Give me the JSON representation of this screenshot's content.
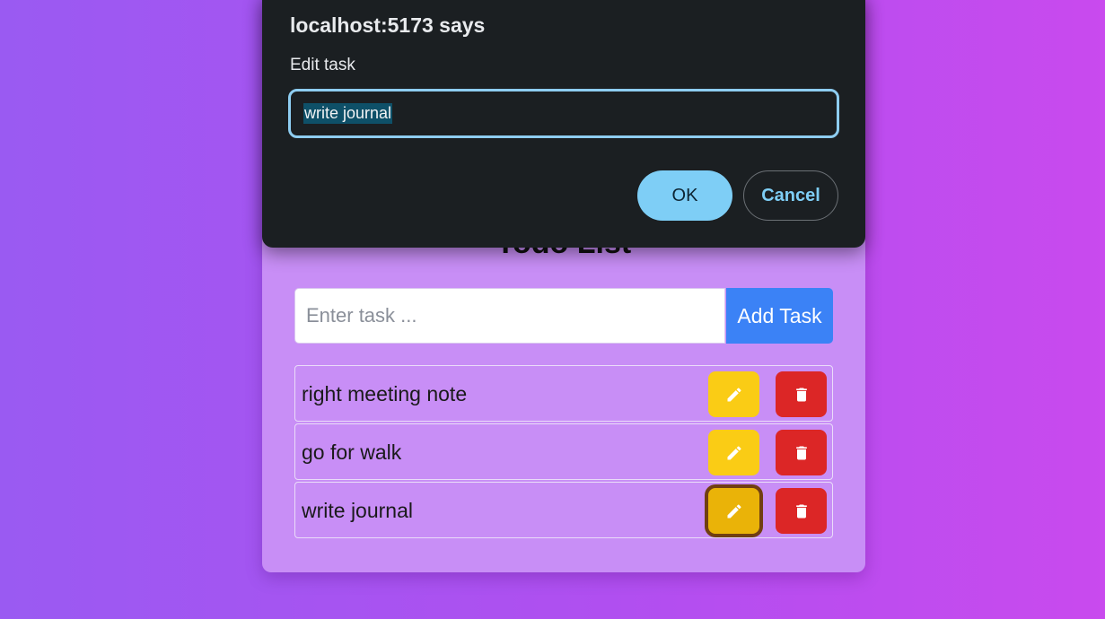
{
  "app": {
    "title": "Todo List",
    "input": {
      "placeholder": "Enter task ...",
      "value": ""
    },
    "add_button_label": "Add Task",
    "tasks": [
      {
        "text": "right meeting note"
      },
      {
        "text": "go for walk"
      },
      {
        "text": "write journal"
      }
    ],
    "edit_icon": "pencil-icon",
    "delete_icon": "trash-icon"
  },
  "dialog": {
    "title": "localhost:5173 says",
    "message": "Edit task",
    "input_value": "write journal",
    "ok_label": "OK",
    "cancel_label": "Cancel"
  },
  "colors": {
    "background_left": "#9a5af2",
    "background_right": "#c94aee",
    "card": "#c88ef6",
    "add_button": "#3b82f6",
    "edit_button": "#facc15",
    "delete_button": "#dc2626",
    "dialog_bg": "#1b1f22",
    "dialog_accent": "#7ecef6"
  }
}
